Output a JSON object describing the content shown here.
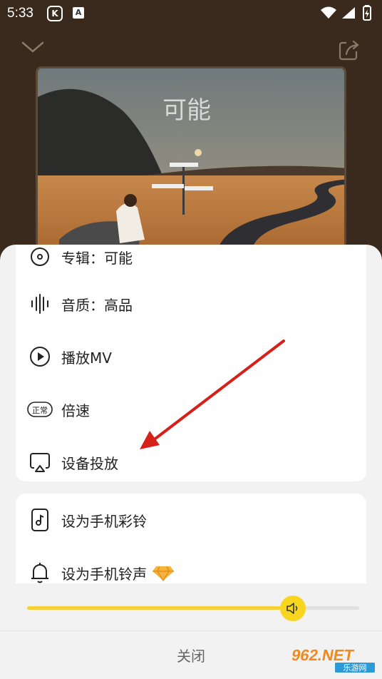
{
  "status": {
    "time": "5:33",
    "app_icon_k": "K",
    "app_icon_a": "A"
  },
  "player": {
    "album_title_art": "可能"
  },
  "menu": {
    "items": [
      {
        "label": "专辑：可能",
        "icon": "disc-icon"
      },
      {
        "label": "音质：高品",
        "icon": "sound-wave-icon"
      },
      {
        "label": "播放MV",
        "icon": "play-circle-icon"
      },
      {
        "label": "倍速",
        "icon": "speed-badge-icon",
        "badge": "正常"
      },
      {
        "label": "设备投放",
        "icon": "cast-icon"
      }
    ],
    "extra_items": [
      {
        "label": "设为手机彩铃",
        "icon": "phone-music-icon"
      },
      {
        "label": "设为手机铃声",
        "icon": "bell-icon",
        "vip_icon": "diamond-icon"
      }
    ]
  },
  "volume": {
    "level": 0.8
  },
  "close_label": "关闭",
  "watermark": {
    "brand": "962.NET",
    "sub": "乐游网"
  },
  "colors": {
    "accent": "#f8d61f",
    "arrow": "#d8201a",
    "sheet_bg": "#f2f2f2"
  }
}
